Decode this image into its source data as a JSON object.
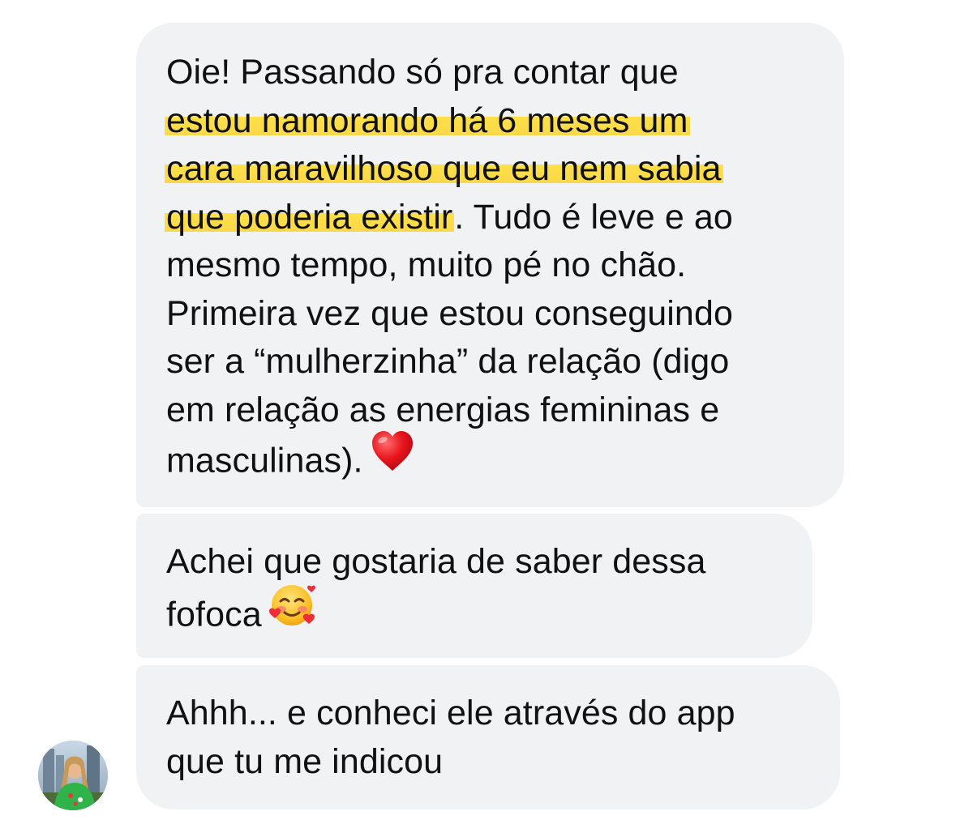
{
  "messages": [
    {
      "lines": [
        [
          {
            "t": "Oie! Passando só pra contar que",
            "hl": false
          }
        ],
        [
          {
            "t": "estou namorando há 6 meses um",
            "hl": true
          }
        ],
        [
          {
            "t": "cara maravilhoso que eu nem sabia",
            "hl": true
          }
        ],
        [
          {
            "t": "que poderia existir",
            "hl": true
          },
          {
            "t": ". Tudo é leve e ao",
            "hl": false
          }
        ],
        [
          {
            "t": "mesmo tempo, muito pé no chão.",
            "hl": false
          }
        ],
        [
          {
            "t": "Primeira vez que estou conseguindo",
            "hl": false
          }
        ],
        [
          {
            "t": "ser a “mulherzinha” da relação (digo",
            "hl": false
          }
        ],
        [
          {
            "t": "em relação as energias femininas e",
            "hl": false
          }
        ],
        [
          {
            "t": "masculinas).",
            "hl": false
          }
        ]
      ],
      "emoji": "red-heart"
    },
    {
      "lines": [
        [
          {
            "t": "Achei que gostaria de saber dessa",
            "hl": false
          }
        ],
        [
          {
            "t": "fofoca",
            "hl": false
          }
        ]
      ],
      "emoji": "smiling-face-with-hearts"
    },
    {
      "lines": [
        [
          {
            "t": "Ahhh... e conheci ele através do app",
            "hl": false
          }
        ],
        [
          {
            "t": "que tu me indicou",
            "hl": false
          }
        ]
      ]
    }
  ],
  "colors": {
    "bubble": "#f1f2f4",
    "highlight": "#fde047",
    "text": "#111111"
  },
  "icons": {
    "avatar": "sender-avatar-photo"
  }
}
